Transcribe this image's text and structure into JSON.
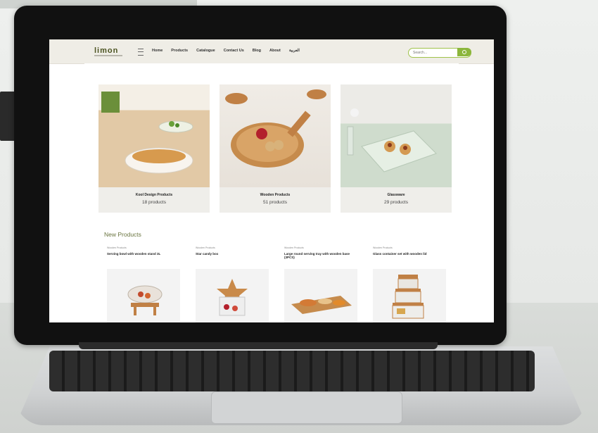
{
  "site": {
    "logo": "limon",
    "nav": [
      "Home",
      "Products",
      "Catalogue",
      "Contact Us",
      "Blog",
      "About",
      "العربية"
    ],
    "search_placeholder": "Search..."
  },
  "categories": [
    {
      "name": "Kool Design Products",
      "count": "18 products"
    },
    {
      "name": "Wooden Products",
      "count": "51 products"
    },
    {
      "name": "Glassware",
      "count": "29 products"
    }
  ],
  "new_products": {
    "title": "New Products",
    "items": [
      {
        "category": "Wooden Products",
        "title": "Serving bowl with wooden stand 3L"
      },
      {
        "category": "Wooden Products",
        "title": "Star candy box"
      },
      {
        "category": "Wooden Products",
        "title": "Large round serving tray with wooden base (3PCS)"
      },
      {
        "category": "Wooden Products",
        "title": "Glass container set with wooden lid"
      }
    ]
  },
  "colors": {
    "accent": "#8cb63c",
    "header_bg": "#efede6",
    "card_bg": "#efeeea"
  }
}
